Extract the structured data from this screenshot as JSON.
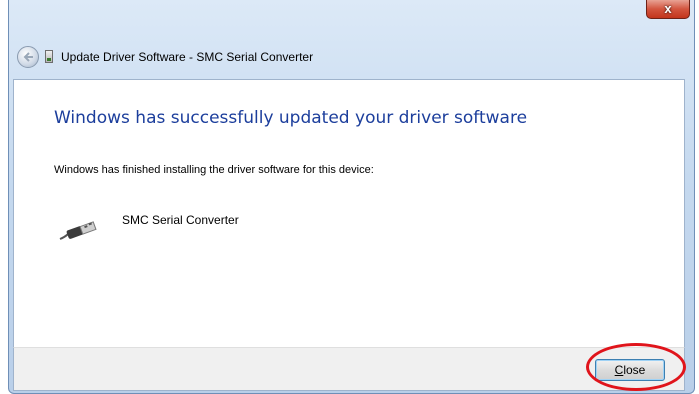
{
  "window": {
    "title": "Update Driver Software - SMC Serial Converter",
    "close_glyph": "x"
  },
  "main": {
    "heading": "Windows has successfully updated your driver software",
    "description": "Windows has finished installing the driver software for this device:",
    "device_name": "SMC Serial Converter",
    "device_icon": "usb-cable-icon"
  },
  "footer": {
    "close_label_underlined": "C",
    "close_label_rest": "lose"
  },
  "colors": {
    "heading": "#1c3e9c",
    "highlight": "#e0141b"
  }
}
